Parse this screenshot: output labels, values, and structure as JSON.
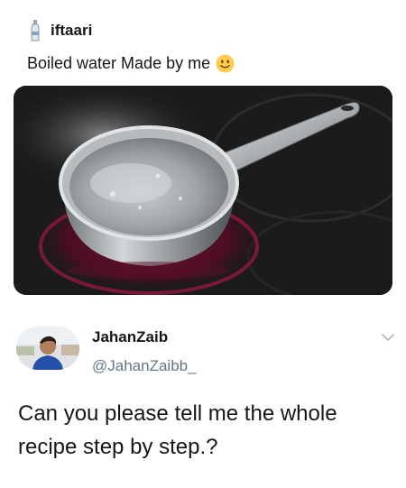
{
  "quoted_tweet": {
    "username": "iftaari",
    "text": "Boiled water Made by me",
    "emoji": "slightly-smiling-face-icon",
    "media": "pot-of-boiling-water-on-stove-image"
  },
  "reply_tweet": {
    "display_name": "JahanZaib",
    "handle": "@JahanZaibb_",
    "text": "Can you please tell me the whole recipe step by step.?",
    "avatar": "profile-photo-avatar",
    "menu_icon": "chevron-down-icon"
  },
  "colors": {
    "text_primary": "#14171a",
    "text_secondary": "#657786",
    "emoji_yellow": "#ffcc4d"
  }
}
